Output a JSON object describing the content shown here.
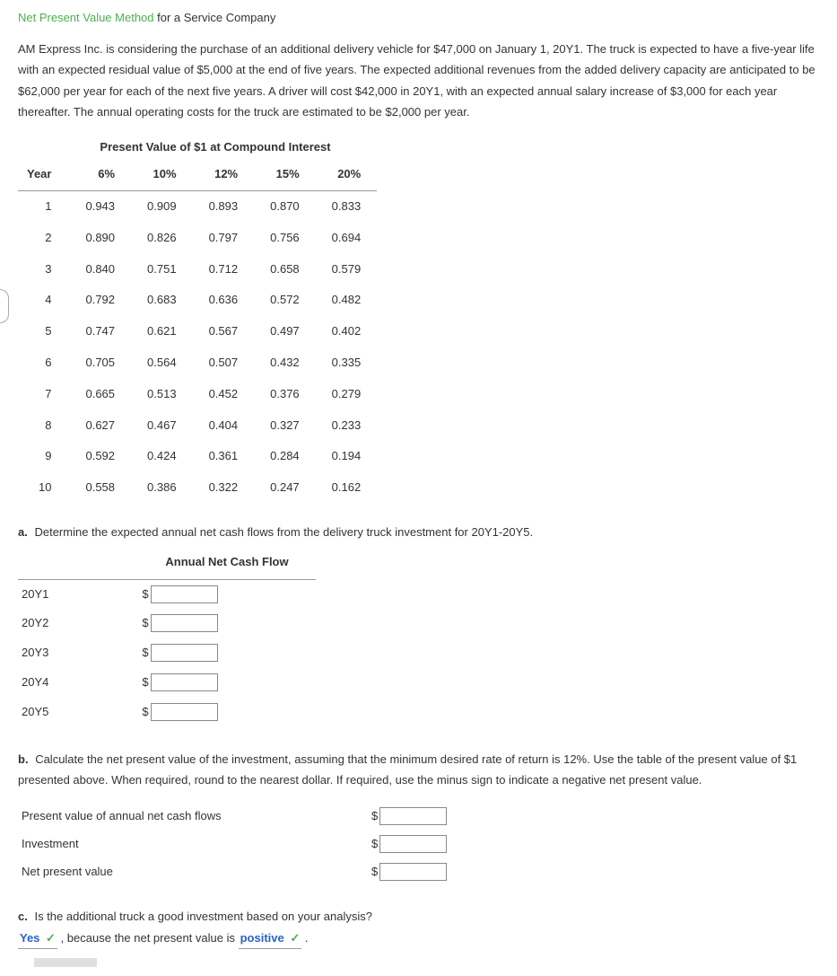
{
  "title": {
    "green_part": "Net Present Value Method",
    "rest": " for a Service Company"
  },
  "problem": "AM Express Inc. is considering the purchase of an additional delivery vehicle for $47,000 on January 1, 20Y1. The truck is expected to have a five-year life with an expected residual value of $5,000 at the end of five years. The expected additional revenues from the added delivery capacity are anticipated to be $62,000 per year for each of the next five years. A driver will cost $42,000 in 20Y1, with an expected annual salary increase of $3,000 for each year thereafter. The annual operating costs for the truck are estimated to be $2,000 per year.",
  "pv_table": {
    "title": "Present Value of $1 at Compound Interest",
    "headers": [
      "Year",
      "6%",
      "10%",
      "12%",
      "15%",
      "20%"
    ],
    "rows": [
      [
        "1",
        "0.943",
        "0.909",
        "0.893",
        "0.870",
        "0.833"
      ],
      [
        "2",
        "0.890",
        "0.826",
        "0.797",
        "0.756",
        "0.694"
      ],
      [
        "3",
        "0.840",
        "0.751",
        "0.712",
        "0.658",
        "0.579"
      ],
      [
        "4",
        "0.792",
        "0.683",
        "0.636",
        "0.572",
        "0.482"
      ],
      [
        "5",
        "0.747",
        "0.621",
        "0.567",
        "0.497",
        "0.402"
      ],
      [
        "6",
        "0.705",
        "0.564",
        "0.507",
        "0.432",
        "0.335"
      ],
      [
        "7",
        "0.665",
        "0.513",
        "0.452",
        "0.376",
        "0.279"
      ],
      [
        "8",
        "0.627",
        "0.467",
        "0.404",
        "0.327",
        "0.233"
      ],
      [
        "9",
        "0.592",
        "0.424",
        "0.361",
        "0.284",
        "0.194"
      ],
      [
        "10",
        "0.558",
        "0.386",
        "0.322",
        "0.247",
        "0.162"
      ]
    ]
  },
  "part_a": {
    "label": "a.",
    "text": "Determine the expected annual net cash flows from the delivery truck investment for 20Y1-20Y5.",
    "col_header": "Annual Net Cash Flow",
    "years": [
      "20Y1",
      "20Y2",
      "20Y3",
      "20Y4",
      "20Y5"
    ],
    "dollar": "$"
  },
  "part_b": {
    "label": "b.",
    "text": "Calculate the net present value of the investment, assuming that the minimum desired rate of return is 12%. Use the table of the present value of $1 presented above. When required, round to the nearest dollar. If required, use the minus sign to indicate a negative net present value.",
    "rows": [
      "Present value of annual net cash flows",
      "Investment",
      "Net present value"
    ],
    "dollar": "$"
  },
  "part_c": {
    "label": "c.",
    "text": "Is the additional truck a good investment based on your analysis?",
    "answer1": "Yes",
    "mid_text": ", because the net present value is ",
    "answer2": "positive",
    "period": " .",
    "check": "✓"
  }
}
